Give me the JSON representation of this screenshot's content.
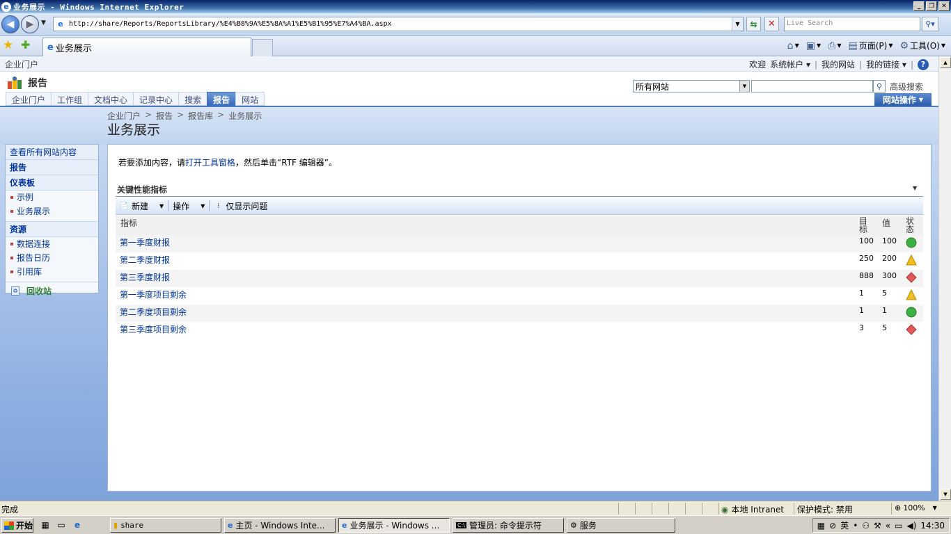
{
  "window": {
    "title": "业务展示 - Windows Internet Explorer",
    "min_label": "_",
    "max_label": "❐",
    "close_label": "✕"
  },
  "address": {
    "url": "http://share/Reports/ReportsLibrary/%E4%B8%9A%E5%8A%A1%E5%B1%95%E7%A4%BA.aspx",
    "search_placeholder": "Live Search"
  },
  "tab": {
    "label": "业务展示"
  },
  "commandbar": {
    "page_label": "页面(P)",
    "tools_label": "工具(O)"
  },
  "sp": {
    "portal_name": "企业门户",
    "welcome": "欢迎",
    "account": "系统帐户",
    "my_site": "我的网站",
    "my_links": "我的链接",
    "site_title": "报告",
    "scope": "所有网站",
    "advanced_search": "高级搜索",
    "site_actions": "网站操作",
    "topnav": [
      "企业门户",
      "工作组",
      "文档中心",
      "记录中心",
      "搜索",
      "报告",
      "网站"
    ],
    "breadcrumb": [
      "企业门户",
      "报告",
      "报告库",
      "业务展示"
    ],
    "page_title": "业务展示",
    "leftnav": {
      "view_all": "查看所有网站内容",
      "reports": "报告",
      "dashboards": "仪表板",
      "dashboard_items": [
        "示例",
        "业务展示"
      ],
      "resources": "资源",
      "resource_items": [
        "数据连接",
        "报告日历",
        "引用库"
      ],
      "recycle": "回收站"
    },
    "hint_prefix": "若要添加内容，请",
    "hint_link": "打开工具窗格",
    "hint_suffix": "，然后单击“RTF 编辑器”。"
  },
  "kpi": {
    "title": "关键性能指标",
    "toolbar": {
      "new": "新建",
      "actions": "操作",
      "problems_only": "仅显示问题"
    },
    "columns": {
      "indicator": "指标",
      "goal_1": "目",
      "goal_2": "标",
      "value": "值",
      "status_1": "状",
      "status_2": "态"
    },
    "rows": [
      {
        "name": "第一季度财报",
        "goal": "100",
        "value": "100",
        "status": "green"
      },
      {
        "name": "第二季度财报",
        "goal": "250",
        "value": "200",
        "status": "yellow"
      },
      {
        "name": "第三季度财报",
        "goal": "888",
        "value": "300",
        "status": "red"
      },
      {
        "name": "第一季度项目剩余",
        "goal": "1",
        "value": "5",
        "status": "yellow"
      },
      {
        "name": "第二季度项目剩余",
        "goal": "1",
        "value": "1",
        "status": "green"
      },
      {
        "name": "第三季度项目剩余",
        "goal": "3",
        "value": "5",
        "status": "red"
      }
    ]
  },
  "statusbar": {
    "status": "完成",
    "zone": "本地 Intranet",
    "protected_mode": "保护模式: 禁用",
    "zoom": "100%"
  },
  "taskbar": {
    "start": "开始",
    "tasks": [
      "share",
      "主页 - Windows Inte...",
      "业务展示 - Windows ...",
      "管理员: 命令提示符",
      "服务"
    ],
    "ime": "英",
    "clock": "14:30"
  },
  "colors": {
    "green": "#3cb043",
    "yellow": "#f2c01e",
    "red": "#e05a5a"
  }
}
